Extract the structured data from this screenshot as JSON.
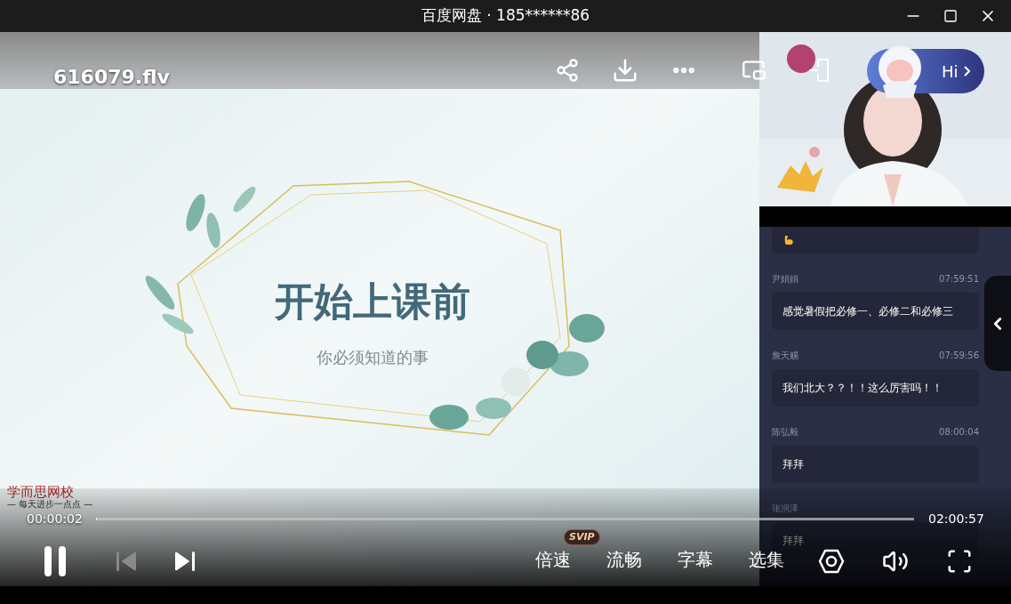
{
  "window": {
    "title": "百度网盘 · 185******86"
  },
  "video": {
    "file_name": "616079.flv"
  },
  "slide": {
    "title": "开始上课前",
    "subtitle": "你必须知道的事",
    "logo": "学而思网校",
    "slogan": "— 每天进步一点点 —"
  },
  "assistant": {
    "label": "Hi"
  },
  "chat": {
    "messages": [
      {
        "kind": "sticker"
      },
      {
        "kind": "text",
        "user": "尹娟娟",
        "time": "07:59:51",
        "text": "感觉暑假把必修一、必修二和必修三"
      },
      {
        "kind": "text",
        "user": "詹天赐",
        "time": "07:59:56",
        "text": "我们北大？？！！这么厉害吗！！"
      },
      {
        "kind": "text",
        "user": "陈弘毅",
        "time": "08:00:04",
        "text": "拜拜"
      },
      {
        "kind": "text",
        "user": "张润泽",
        "text": "拜拜"
      }
    ]
  },
  "player": {
    "current_time": "00:00:02",
    "total_time": "02:00:57",
    "level": 0.0003,
    "playing": true,
    "previous_disabled": true,
    "options": [
      {
        "label": "倍速",
        "badge": "SVIP"
      },
      {
        "label": "流畅"
      },
      {
        "label": "字幕"
      },
      {
        "label": "选集"
      }
    ]
  }
}
